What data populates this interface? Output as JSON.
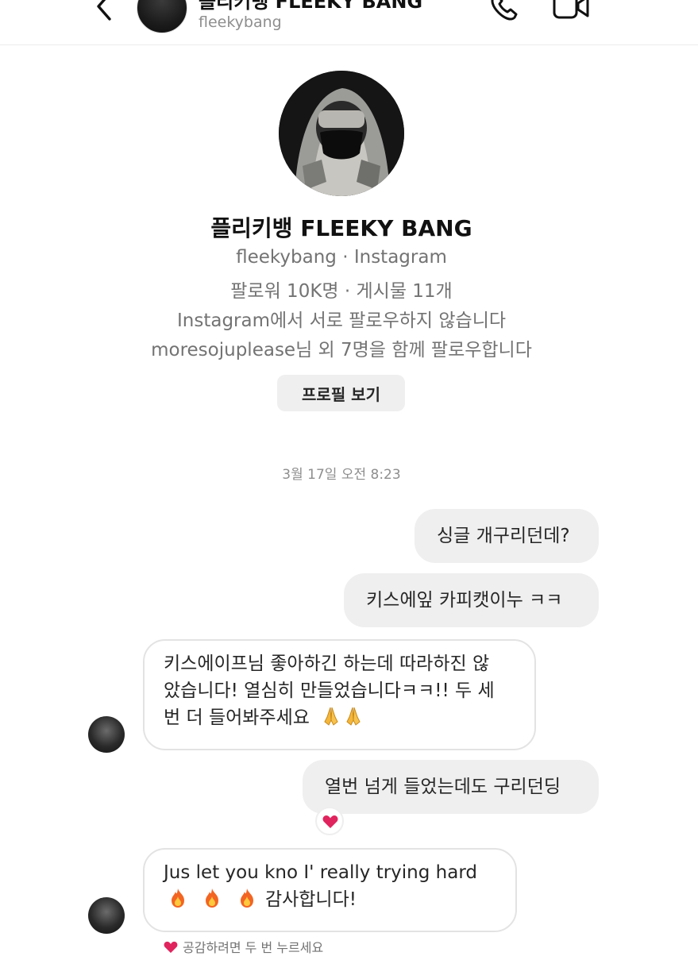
{
  "header": {
    "title": "플리키뱅 FLEEKY BANG",
    "username": "fleekybang"
  },
  "profile": {
    "name": "플리키뱅 FLEEKY BANG",
    "source": "fleekybang · Instagram",
    "stats": "팔로워 10K명 · 게시물 11개",
    "follow_status": "Instagram에서 서로 팔로우하지 않습니다",
    "mutual": "moresojuplease님 외 7명을 함께 팔로우합니다",
    "view_profile_button": "프로필 보기"
  },
  "conversation": {
    "timestamp": "3월 17일  오전 8:23",
    "messages": [
      {
        "from": "me",
        "lines": [
          "싱글 개구리던데?"
        ]
      },
      {
        "from": "me",
        "lines": [
          "키스에잎 카피캣이누 ㅋㅋ"
        ]
      },
      {
        "from": "them",
        "lines": [
          "키스에이프님 좋아하긴 하는데 따라하진 않",
          "았습니다! 열심히 만들었습니다ㅋㅋ!! 두 세",
          "번 더 들어봐주세요"
        ]
      },
      {
        "from": "me",
        "lines": [
          "열번 넘게 들었는데도 구리던딩"
        ],
        "reaction": "heart"
      },
      {
        "from": "them",
        "lines": [
          "Jus let you kno I' really trying hard",
          "감사합니다!"
        ]
      }
    ],
    "like_hint": "공감하려면 두 번 누르세요"
  },
  "icons": {
    "back": "chevron-left-icon",
    "call": "phone-icon",
    "video": "video-camera-icon",
    "reaction": "heart-icon",
    "pray": "folded-hands-emoji",
    "fire": "fire-emoji"
  },
  "colors": {
    "sent_bubble": "#efefef",
    "received_border": "#e3e3e3",
    "heart": "#e0245e",
    "button_bg": "#efefef"
  }
}
